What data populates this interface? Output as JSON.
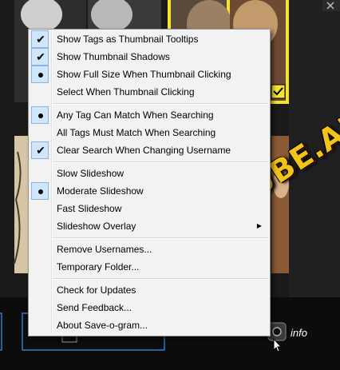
{
  "menu": {
    "groups": [
      [
        {
          "label": "Show Tags as Thumbnail Tooltips",
          "state": "checked"
        },
        {
          "label": "Show Thumbnail Shadows",
          "state": "checked"
        },
        {
          "label": "Show Full Size When Thumbnail Clicking",
          "state": "selected"
        },
        {
          "label": "Select When Thumbnail Clicking",
          "state": "none"
        }
      ],
      [
        {
          "label": "Any Tag Can Match When Searching",
          "state": "selected"
        },
        {
          "label": "All Tags Must Match When Searching",
          "state": "none"
        },
        {
          "label": "Clear Search When Changing Username",
          "state": "checked"
        }
      ],
      [
        {
          "label": "Slow Slideshow",
          "state": "none"
        },
        {
          "label": "Moderate Slideshow",
          "state": "selected"
        },
        {
          "label": "Fast Slideshow",
          "state": "none"
        },
        {
          "label": "Slideshow Overlay",
          "state": "none",
          "submenu": true
        }
      ],
      [
        {
          "label": "Remove Usernames...",
          "state": "none"
        },
        {
          "label": "Temporary Folder...",
          "state": "none"
        }
      ],
      [
        {
          "label": "Check for Updates",
          "state": "none"
        },
        {
          "label": "Send Feedback...",
          "state": "none"
        },
        {
          "label": "About Save-o-gram...",
          "state": "none"
        }
      ]
    ]
  },
  "icons": {
    "check": "check-mark-icon",
    "radio": "radio-dot-icon",
    "submenu": "submenu-arrow-icon",
    "close": "close-icon",
    "camera": "camera-icon"
  },
  "bottom_bar": {
    "info_label": "info"
  },
  "watermark": {
    "text": "MYTUBE.AM"
  },
  "colors": {
    "menu_bg": "#f2f2f2",
    "check_bg": "#cfe6fb",
    "check_border": "#8db2e3",
    "selection_frame": "#f3e233",
    "accent_blue": "#2f79c5",
    "watermark": "#f0c419"
  }
}
